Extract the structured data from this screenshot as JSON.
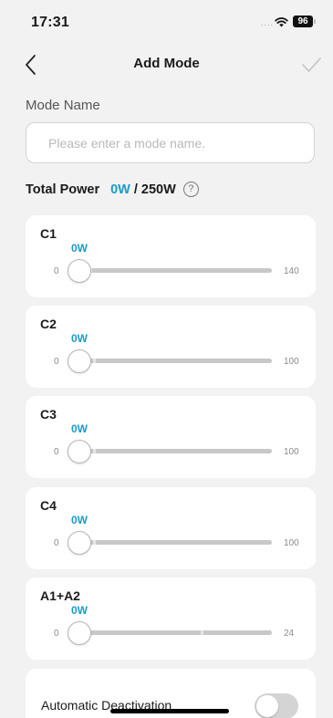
{
  "status_bar": {
    "time": "17:31",
    "battery": "96",
    "signal": "....",
    "icons": [
      "wifi-icon",
      "battery-icon"
    ]
  },
  "nav": {
    "title": "Add Mode",
    "back_icon": "chevron-left-icon",
    "confirm_icon": "checkmark-icon"
  },
  "mode_name": {
    "label": "Mode Name",
    "placeholder": "Please enter a mode name.",
    "value": ""
  },
  "total_power": {
    "label": "Total Power",
    "value": "0W",
    "max": "250W",
    "separator": "/",
    "help_icon": "question-circle-icon",
    "help_glyph": "?"
  },
  "ports": [
    {
      "name": "C1",
      "value_label": "0W",
      "min": "0",
      "max": "140",
      "value": 0,
      "tick_fraction": 0.05
    },
    {
      "name": "C2",
      "value_label": "0W",
      "min": "0",
      "max": "100",
      "value": 0,
      "tick_fraction": 0.07
    },
    {
      "name": "C3",
      "value_label": "0W",
      "min": "0",
      "max": "100",
      "value": 0,
      "tick_fraction": 0.07
    },
    {
      "name": "C4",
      "value_label": "0W",
      "min": "0",
      "max": "100",
      "value": 0,
      "tick_fraction": 0.07
    },
    {
      "name": "A1+A2",
      "value_label": "0W",
      "min": "0",
      "max": "24",
      "value": 0,
      "tick_fraction": 0.63
    }
  ],
  "auto_deactivation": {
    "label": "Automatic Deactivation",
    "enabled": false
  },
  "colors": {
    "accent": "#1b9bc8",
    "background": "#f2f2f2",
    "card": "#ffffff",
    "track": "#c8c8c8"
  }
}
